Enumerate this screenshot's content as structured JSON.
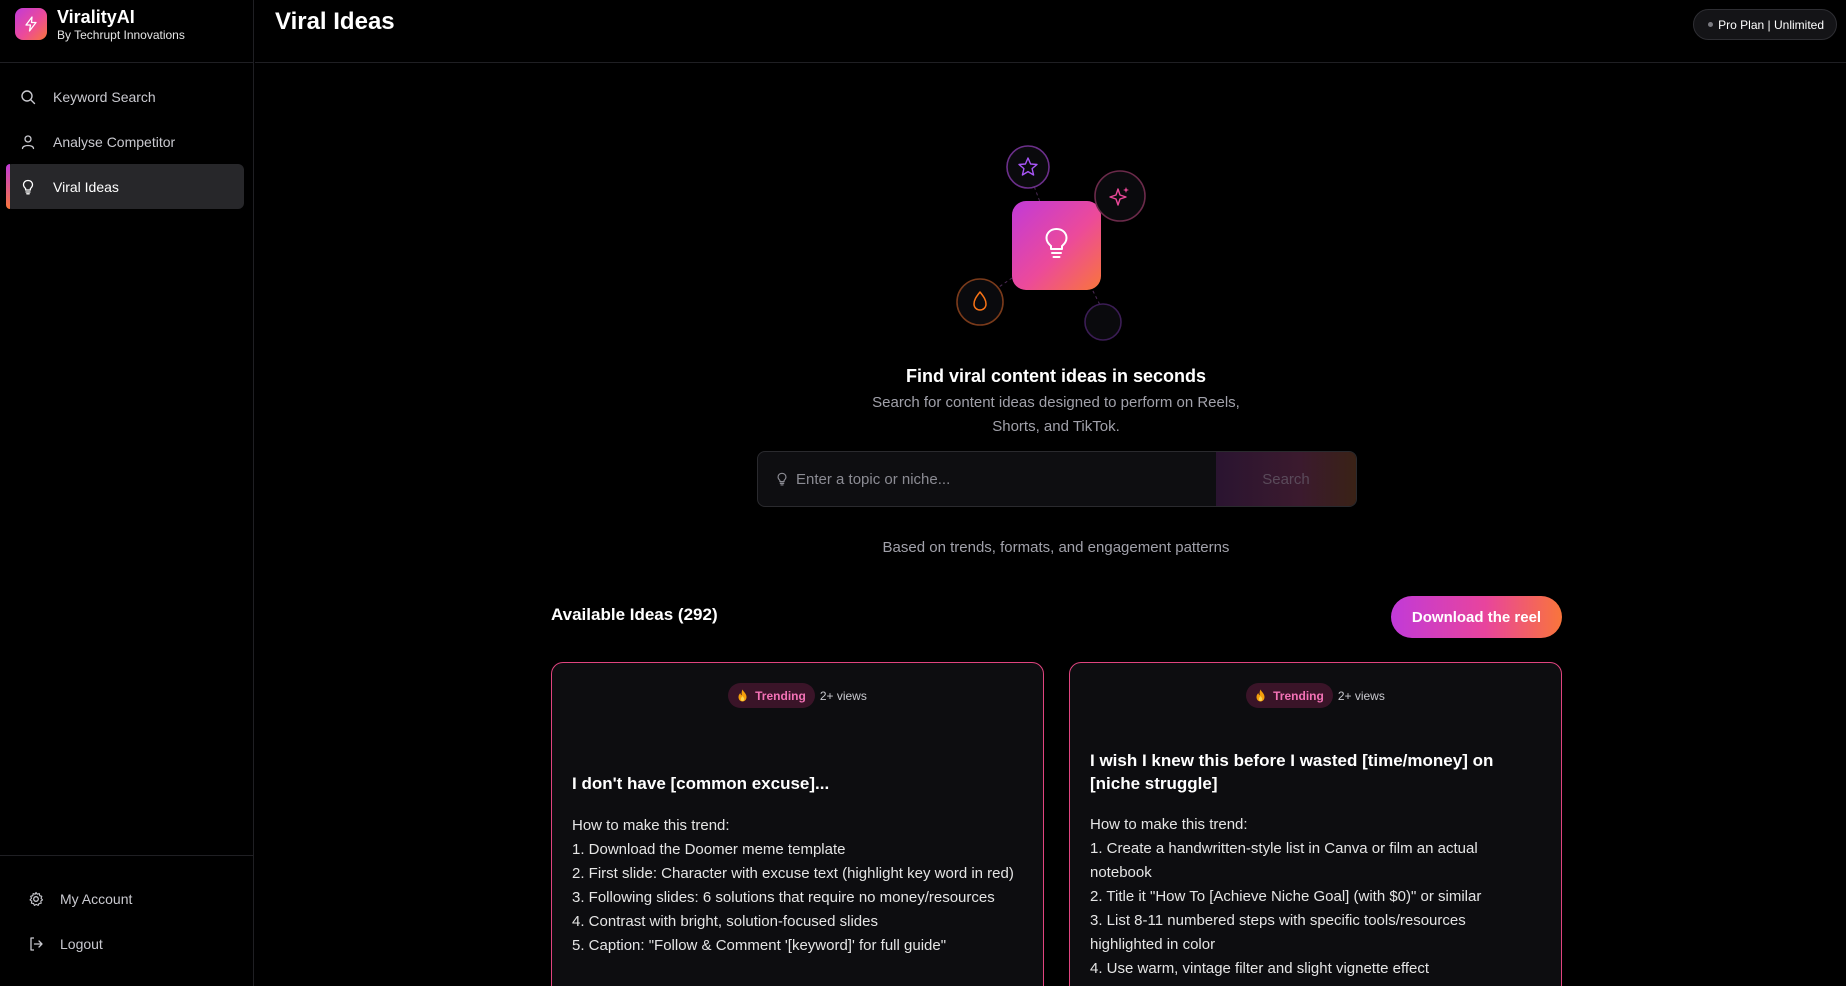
{
  "brand": {
    "name": "ViralityAI",
    "subtitle": "By Techrupt Innovations"
  },
  "sidebar": {
    "items": [
      {
        "label": "Keyword Search",
        "icon": "search-icon"
      },
      {
        "label": "Analyse Competitor",
        "icon": "user-icon"
      },
      {
        "label": "Viral Ideas",
        "icon": "lightbulb-icon",
        "active": true
      }
    ],
    "bottom": [
      {
        "label": "My Account",
        "icon": "gear-icon"
      },
      {
        "label": "Logout",
        "icon": "logout-icon"
      }
    ]
  },
  "header": {
    "title": "Viral Ideas",
    "plan": "Pro Plan | Unlimited"
  },
  "hero": {
    "title": "Find viral content ideas in seconds",
    "subtitle": "Search for content ideas designed to perform on Reels, Shorts, and TikTok.",
    "placeholder": "Enter a topic or niche...",
    "search_label": "Search",
    "hint": "Based on trends, formats, and engagement patterns"
  },
  "ideas": {
    "title": "Available Ideas (292)",
    "download_label": "Download the reel",
    "cards": [
      {
        "badge": "Trending",
        "views": "2+ views",
        "title": "I don't have [common excuse]...",
        "intro": "How to make this trend:",
        "steps": [
          "1. Download the Doomer meme template",
          "2. First slide: Character with excuse text (highlight key word in red)",
          "3. Following slides: 6 solutions that require no money/resources",
          "4. Contrast with bright, solution-focused slides",
          "5. Caption: \"Follow & Comment '[keyword]' for full guide\""
        ]
      },
      {
        "badge": "Trending",
        "views": "2+ views",
        "title": "I wish I knew this before I wasted [time/money] on [niche struggle]",
        "intro": "How to make this trend:",
        "steps": [
          "1. Create a handwritten-style list in Canva or film an actual notebook",
          "2. Title it \"How To [Achieve Niche Goal] (with $0)\" or similar",
          "3. List 8-11 numbered steps with specific tools/resources highlighted in color",
          "4. Use warm, vintage filter and slight vignette effect"
        ]
      }
    ]
  },
  "colors": {
    "accent_start": "#c13ad8",
    "accent_mid": "#ec4a9a",
    "accent_end": "#f9753b",
    "trend_text": "#f472b6"
  }
}
